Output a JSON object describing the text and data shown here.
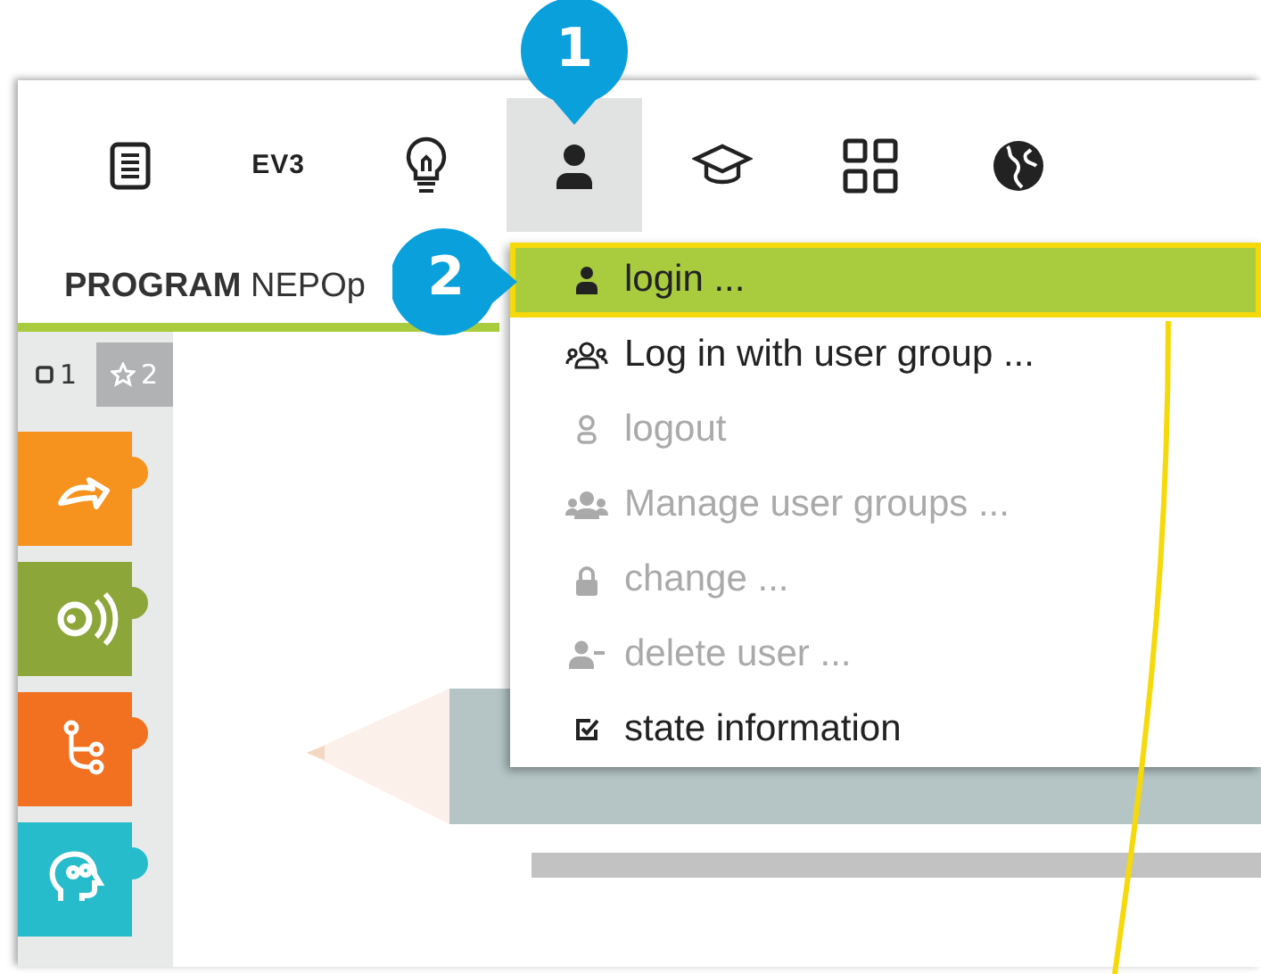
{
  "toolbar": [
    {
      "kind": "document",
      "selected": false
    },
    {
      "kind": "ev3",
      "label": "EV3",
      "selected": false
    },
    {
      "kind": "bulb",
      "selected": false
    },
    {
      "kind": "user",
      "selected": true
    },
    {
      "kind": "cap",
      "selected": false
    },
    {
      "kind": "grid",
      "selected": false
    },
    {
      "kind": "globe",
      "selected": false
    }
  ],
  "program": {
    "prefix": "PROGRAM",
    "name": "NEPOp"
  },
  "sidebar": {
    "tabs": [
      {
        "label": "1",
        "kind": "square",
        "selected": false
      },
      {
        "label": "2",
        "kind": "star",
        "selected": true
      }
    ],
    "blocks": [
      {
        "kind": "action",
        "color": "#f5931e"
      },
      {
        "kind": "sensor",
        "color": "#8ca63a"
      },
      {
        "kind": "control",
        "color": "#f27121"
      },
      {
        "kind": "logic",
        "color": "#26bccb"
      }
    ]
  },
  "menu": [
    {
      "label": "login ...",
      "kind": "user",
      "selected": true,
      "disabled": false
    },
    {
      "label": "Log in with user group ...",
      "kind": "group",
      "selected": false,
      "disabled": false
    },
    {
      "label": "logout",
      "kind": "user-outline",
      "selected": false,
      "disabled": true
    },
    {
      "label": "Manage user groups ...",
      "kind": "group-solid",
      "selected": false,
      "disabled": true
    },
    {
      "label": "change ...",
      "kind": "lock",
      "selected": false,
      "disabled": true
    },
    {
      "label": "delete user ...",
      "kind": "user-minus",
      "selected": false,
      "disabled": true
    },
    {
      "label": "state information",
      "kind": "check",
      "selected": false,
      "disabled": false
    }
  ],
  "callouts": [
    {
      "label": "1",
      "kind": "down"
    },
    {
      "label": "2",
      "kind": "right"
    }
  ]
}
